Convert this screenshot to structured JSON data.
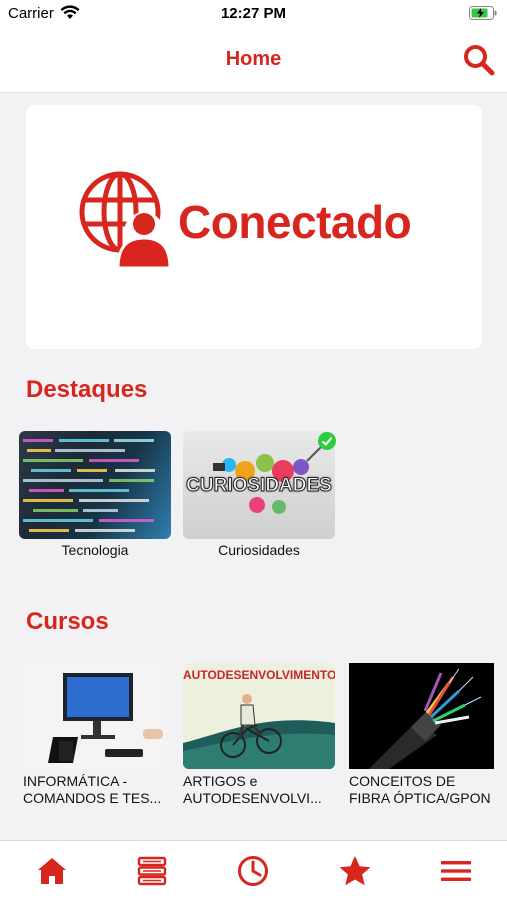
{
  "status_bar": {
    "carrier": "Carrier",
    "time": "12:27 PM"
  },
  "nav": {
    "title": "Home"
  },
  "banner": {
    "logo_text": "Conectado"
  },
  "colors": {
    "accent": "#d8261e",
    "background": "#f2f2f5",
    "badge": "#2ecc40"
  },
  "destaques": {
    "title": "Destaques",
    "items": [
      {
        "label": "Tecnologia",
        "icon": "code-screen-image"
      },
      {
        "label": "Curiosidades",
        "icon": "curiosidades-image",
        "badge_text": "CURIOSIDADES",
        "selected": true
      }
    ]
  },
  "cursos": {
    "title": "Cursos",
    "items": [
      {
        "line1": "INFORMÁTICA -",
        "line2": "COMANDOS E TES...",
        "icon": "computer-desk-image"
      },
      {
        "line1": "ARTIGOS e",
        "line2": "AUTODESENVOLVI...",
        "image_text": "AUTODESENVOLVIMENTO",
        "icon": "cyclist-image"
      },
      {
        "line1": "CONCEITOS DE",
        "line2": "FIBRA ÓPTICA/GPON",
        "icon": "fiber-optic-image"
      }
    ]
  },
  "tabs": [
    "home-icon",
    "books-icon",
    "clock-icon",
    "star-icon",
    "menu-icon"
  ]
}
